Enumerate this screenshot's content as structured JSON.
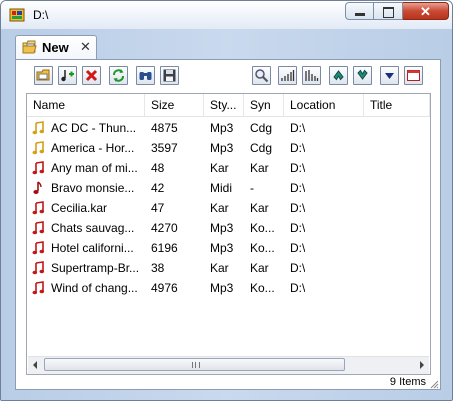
{
  "window": {
    "title": "D:\\",
    "colors": {
      "accent": "#b9cde6",
      "close": "#c94a34"
    }
  },
  "tab": {
    "label": "New",
    "close_glyph": "✕"
  },
  "caption": {
    "close_glyph": "✕"
  },
  "toolbar": {
    "left_icons": [
      "open-folder-icon",
      "add-music-icon",
      "delete-icon",
      "refresh-icon",
      "find-icon",
      "save-icon"
    ],
    "right_icons": [
      "zoom-icon",
      "sort-ascending-bars-icon",
      "sort-descending-bars-icon",
      "move-up-icon",
      "move-down-icon",
      "dropdown-icon",
      "window-icon"
    ]
  },
  "list": {
    "columns": [
      "Name",
      "Size",
      "Sty...",
      "Syn",
      "Location",
      "Title"
    ],
    "rows": [
      {
        "icon": "note-yellow",
        "name": "AC DC - Thun...",
        "size": "4875",
        "style": "Mp3",
        "syn": "Cdg",
        "location": "D:\\"
      },
      {
        "icon": "note-yellow",
        "name": "America - Hor...",
        "size": "3597",
        "style": "Mp3",
        "syn": "Cdg",
        "location": "D:\\"
      },
      {
        "icon": "note-red",
        "name": "Any man of mi...",
        "size": "48",
        "style": "Kar",
        "syn": "Kar",
        "location": "D:\\"
      },
      {
        "icon": "note-single",
        "name": "Bravo monsie...",
        "size": "42",
        "style": "Midi",
        "syn": "-",
        "location": "D:\\"
      },
      {
        "icon": "note-red",
        "name": "Cecilia.kar",
        "size": "47",
        "style": "Kar",
        "syn": "Kar",
        "location": "D:\\"
      },
      {
        "icon": "note-red",
        "name": "Chats sauvag...",
        "size": "4270",
        "style": "Mp3",
        "syn": "Ko...",
        "location": "D:\\"
      },
      {
        "icon": "note-red",
        "name": "Hotel californi...",
        "size": "6196",
        "style": "Mp3",
        "syn": "Ko...",
        "location": "D:\\"
      },
      {
        "icon": "note-red",
        "name": "Supertramp-Br...",
        "size": "38",
        "style": "Kar",
        "syn": "Kar",
        "location": "D:\\"
      },
      {
        "icon": "note-red",
        "name": "Wind of chang...",
        "size": "4976",
        "style": "Mp3",
        "syn": "Ko...",
        "location": "D:\\"
      }
    ]
  },
  "status": {
    "count": "9 Items"
  }
}
